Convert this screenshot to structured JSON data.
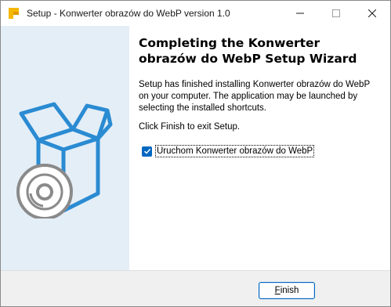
{
  "window": {
    "title": "Setup - Konwerter obrazów do WebP version 1.0"
  },
  "icons": {
    "app": "setup-icon",
    "minimize": "minimize-icon",
    "maximize": "maximize-icon",
    "close": "close-icon",
    "illustration": "box-with-disc-icon",
    "checkmark": "checkmark-icon"
  },
  "colors": {
    "accent": "#0067c0",
    "illustration_blue": "#2a8bd2",
    "left_panel": "#e4eef7"
  },
  "main": {
    "heading": "Completing the Konwerter obrazów do WebP Setup Wizard",
    "body": "Setup has finished installing Konwerter obrazów do WebP on your computer. The application may be launched by selecting the installed shortcuts.",
    "finish_hint": "Click Finish to exit Setup.",
    "launch_checkbox": {
      "label": "Uruchom Konwerter obrazów do WebP",
      "checked": true
    }
  },
  "footer": {
    "finish_label_accel": "F",
    "finish_label_rest": "inish"
  }
}
